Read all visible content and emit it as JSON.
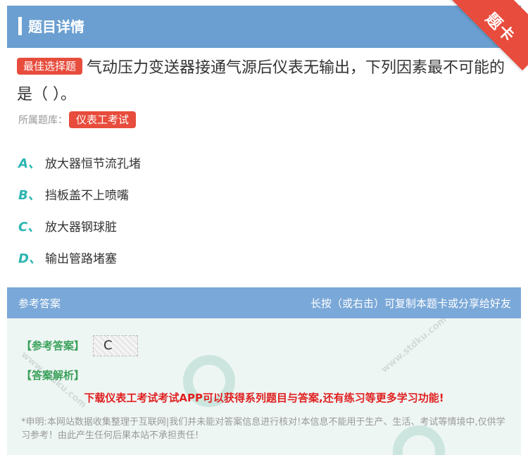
{
  "header": {
    "title": "题目详情"
  },
  "corner": {
    "label": "题卡"
  },
  "question": {
    "badge": "最佳选择题",
    "text": "气动压力变送器接通气源后仪表无输出，下列因素最不可能的是（ ）。"
  },
  "bank": {
    "label": "所属题库：",
    "tag": "仪表工考试"
  },
  "options": [
    {
      "letter": "A、",
      "text": "放大器恒节流孔堵"
    },
    {
      "letter": "B、",
      "text": "挡板盖不上喷嘴"
    },
    {
      "letter": "C、",
      "text": "放大器钢球脏"
    },
    {
      "letter": "D、",
      "text": "输出管路堵塞"
    }
  ],
  "answer_section": {
    "title": "参考答案",
    "hint": "长按（或右击）可复制本题卡或分享给好友",
    "answer_label": "【参考答案】",
    "answer_value": "C",
    "analysis_label": "【答案解析】",
    "promo": "下载仪表工考试考试APP可以获得系列题目与答案,还有练习等更多学习功能!",
    "disclaimer": "*申明:本网站数据收集整理于互联网|我们并未能对答案信息进行核对!本信息不能用于生产、生活、考试等情境中,仅供学习参考！由此产生任何后果本站不承担责任!"
  },
  "watermark": {
    "site": "www.stdku.com"
  }
}
